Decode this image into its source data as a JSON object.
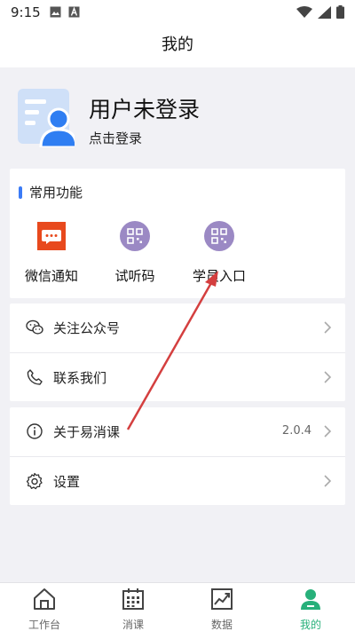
{
  "status_bar": {
    "time": "9:15",
    "icons": [
      "image-icon",
      "keyboard-a-icon",
      "wifi-icon",
      "signal-icon",
      "battery-icon"
    ]
  },
  "header": {
    "title": "我的"
  },
  "profile": {
    "name": "用户未登录",
    "login_prompt": "点击登录"
  },
  "common_functions": {
    "title": "常用功能",
    "items": [
      {
        "label": "微信通知",
        "icon": "wechat-notify-icon",
        "color": "#e8491d"
      },
      {
        "label": "试听码",
        "icon": "qr-code-icon",
        "color": "#9b89c4"
      },
      {
        "label": "学员入口",
        "icon": "qr-code-icon",
        "color": "#9b89c4"
      }
    ]
  },
  "menu_group_1": [
    {
      "label": "关注公众号",
      "icon": "wechat-icon"
    },
    {
      "label": "联系我们",
      "icon": "phone-icon"
    }
  ],
  "menu_group_2": [
    {
      "label": "关于易消课",
      "icon": "info-icon",
      "value": "2.0.4"
    },
    {
      "label": "设置",
      "icon": "gear-icon"
    }
  ],
  "tabbar": {
    "items": [
      {
        "label": "工作台",
        "icon": "home-icon",
        "active": false
      },
      {
        "label": "消课",
        "icon": "calendar-icon",
        "active": false
      },
      {
        "label": "数据",
        "icon": "chart-icon",
        "active": false
      },
      {
        "label": "我的",
        "icon": "person-icon",
        "active": true
      }
    ],
    "active_color": "#27b07a"
  },
  "colors": {
    "accent": "#3b7bf6",
    "annotation_arrow": "#d43f3f"
  }
}
